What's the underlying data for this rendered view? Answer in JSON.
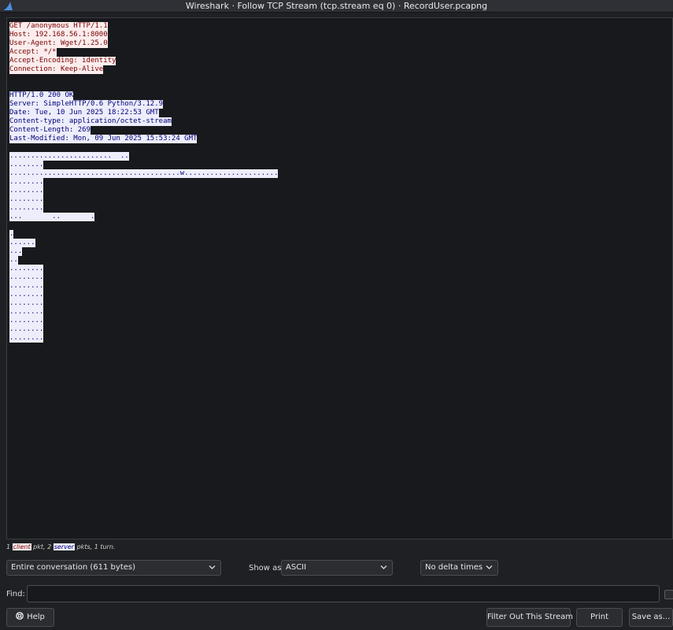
{
  "window": {
    "title": "Wireshark · Follow TCP Stream (tcp.stream eq 0) · RecordUser.pcapng"
  },
  "stream": {
    "client_lines": [
      "GET /anonymous HTTP/1.1",
      "Host: 192.168.56.1:8000",
      "User-Agent: Wget/1.25.0",
      "Accept: */*",
      "Accept-Encoding: identity",
      "Connection: Keep-Alive"
    ],
    "server_headers": [
      "HTTP/1.0 200 OK",
      "Server: SimpleHTTP/0.6 Python/3.12.9",
      "Date: Tue, 10 Jun 2025 18:22:53 GMT",
      "Content-type: application/octet-stream",
      "Content-Length: 269",
      "Last-Modified: Mon, 09 Jun 2025 15:53:24 GMT"
    ],
    "server_body_a": [
      "........................  ..",
      "........",
      "........................................w......................",
      "........",
      "........",
      "........",
      "........",
      "...       ..       ."
    ],
    "server_body_b": [
      ".",
      "......",
      "...",
      "..",
      "........",
      "........",
      "........",
      "........",
      "........",
      "........",
      "........",
      "........",
      "........"
    ]
  },
  "summary": {
    "prefix": "1 ",
    "client_word": "client",
    "middle": " pkt, 2 ",
    "server_word": "server",
    "suffix": " pkts, 1 turn."
  },
  "controls": {
    "conversation": "Entire conversation (611 bytes)",
    "show_as_label": "Show as",
    "show_as_value": "ASCII",
    "delta": "No delta times",
    "find_label": "Find:",
    "find_value": "",
    "help": "Help",
    "filter_out": "Filter Out This Stream",
    "print": "Print",
    "save_as": "Save as..."
  },
  "colors": {
    "client_bg": "#fbeded",
    "client_fg": "#7a0000",
    "server_bg": "#ededfb",
    "server_fg": "#00007a",
    "window_bg": "#1f2023"
  }
}
